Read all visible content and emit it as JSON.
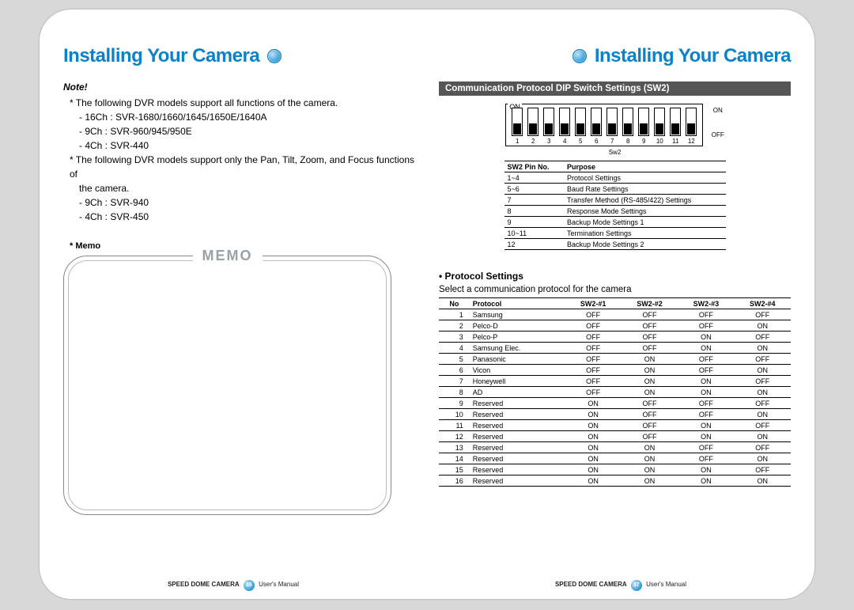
{
  "left": {
    "title": "Installing Your Camera",
    "note_heading": "Note!",
    "line1": "* The following DVR models support all functions of the camera.",
    "l1a": "- 16Ch : SVR-1680/1660/1645/1650E/1640A",
    "l1b": "- 9Ch : SVR-960/945/950E",
    "l1c": "- 4Ch : SVR-440",
    "line2a": "* The following DVR models support only the Pan, Tilt, Zoom, and Focus functions of",
    "line2b": "the camera.",
    "l2a": "- 9Ch : SVR-940",
    "l2b": "- 4Ch : SVR-450",
    "memo_label": "* Memo",
    "memo_box_title": "MEMO"
  },
  "right": {
    "title": "Installing Your Camera",
    "section_heading": "Communication Protocol DIP Switch Settings (SW2)",
    "dip_caption": "Sw2",
    "dip_on": "ON",
    "dip_off": "OFF",
    "sw2_table_head": [
      "SW2 Pin No.",
      "Purpose"
    ],
    "sw2_table": [
      [
        "1~4",
        "Protocol Settings"
      ],
      [
        "5~6",
        "Baud Rate Settings"
      ],
      [
        "7",
        "Transfer Method (RS-485/422) Settings"
      ],
      [
        "8",
        "Response Mode Settings"
      ],
      [
        "9",
        "Backup Mode Settings 1"
      ],
      [
        "10~11",
        "Termination Settings"
      ],
      [
        "12",
        "Backup Mode Settings 2"
      ]
    ],
    "proto_heading": "• Protocol Settings",
    "proto_desc": "Select a communication protocol for the camera",
    "proto_head": [
      "No",
      "Protocol",
      "SW2-#1",
      "SW2-#2",
      "SW2-#3",
      "SW2-#4"
    ],
    "proto_rows": [
      [
        "1",
        "Samsung",
        "OFF",
        "OFF",
        "OFF",
        "OFF"
      ],
      [
        "2",
        "Pelco-D",
        "OFF",
        "OFF",
        "OFF",
        "ON"
      ],
      [
        "3",
        "Pelco-P",
        "OFF",
        "OFF",
        "ON",
        "OFF"
      ],
      [
        "4",
        "Samsung Elec.",
        "OFF",
        "OFF",
        "ON",
        "ON"
      ],
      [
        "5",
        "Panasonic",
        "OFF",
        "ON",
        "OFF",
        "OFF"
      ],
      [
        "6",
        "Vicon",
        "OFF",
        "ON",
        "OFF",
        "ON"
      ],
      [
        "7",
        "Honeywell",
        "OFF",
        "ON",
        "ON",
        "OFF"
      ],
      [
        "8",
        "AD",
        "OFF",
        "ON",
        "ON",
        "ON"
      ],
      [
        "9",
        "Reserved",
        "ON",
        "OFF",
        "OFF",
        "OFF"
      ],
      [
        "10",
        "Reserved",
        "ON",
        "OFF",
        "OFF",
        "ON"
      ],
      [
        "11",
        "Reserved",
        "ON",
        "OFF",
        "ON",
        "OFF"
      ],
      [
        "12",
        "Reserved",
        "ON",
        "OFF",
        "ON",
        "ON"
      ],
      [
        "13",
        "Reserved",
        "ON",
        "ON",
        "OFF",
        "OFF"
      ],
      [
        "14",
        "Reserved",
        "ON",
        "ON",
        "OFF",
        "ON"
      ],
      [
        "15",
        "Reserved",
        "ON",
        "ON",
        "ON",
        "OFF"
      ],
      [
        "16",
        "Reserved",
        "ON",
        "ON",
        "ON",
        "ON"
      ]
    ]
  },
  "footer": {
    "product": "SPEED DOME CAMERA",
    "manual": "User's Manual",
    "page_left": "16",
    "page_right": "17"
  }
}
